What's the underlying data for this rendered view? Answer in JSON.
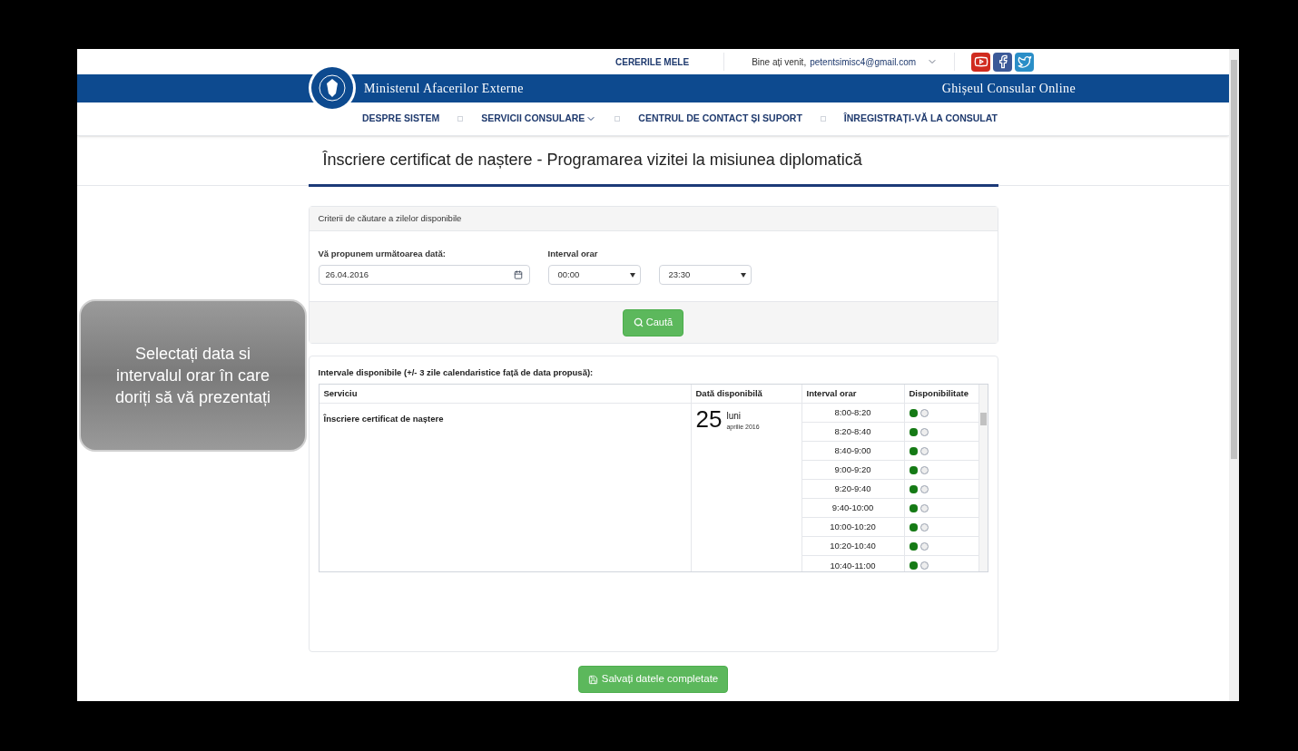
{
  "top_bar": {
    "my_requests": "CERERILE MELE",
    "welcome": "Bine ați venit,",
    "email": "petentsimisc4@gmail.com"
  },
  "header": {
    "ministry": "Ministerul Afacerilor Externe",
    "portal": "Ghișeul Consular Online"
  },
  "nav": [
    {
      "label": "DESPRE SISTEM",
      "dropdown": false
    },
    {
      "label": "SERVICII CONSULARE",
      "dropdown": true
    },
    {
      "label": "CENTRUL DE CONTACT ȘI SUPORT",
      "dropdown": false
    },
    {
      "label": "ÎNREGISTRAȚI-VĂ LA CONSULAT",
      "dropdown": false
    }
  ],
  "page_title": "Înscriere certificat de naștere - Programarea vizitei la misiunea diplomatică",
  "search_panel": {
    "heading": "Criterii de căutare a zilelor disponibile",
    "date_label": "Vă propunem următoarea dată:",
    "date_value": "26.04.2016",
    "interval_label": "Interval orar",
    "from": "00:00",
    "to": "23:30",
    "search_button": "Caută"
  },
  "results": {
    "heading": "Intervale disponibile (+/- 3 zile calendaristice față de data propusă):",
    "columns": [
      "Serviciu",
      "Dată disponibilă",
      "Interval orar",
      "Disponibilitate"
    ],
    "service": "Înscriere certificat de naștere",
    "day": "25",
    "weekday": "luni",
    "month": "aprilie 2016",
    "slots": [
      {
        "time": "8:00-8:20",
        "available": true,
        "selected": false
      },
      {
        "time": "8:20-8:40",
        "available": true,
        "selected": false
      },
      {
        "time": "8:40-9:00",
        "available": true,
        "selected": false
      },
      {
        "time": "9:00-9:20",
        "available": true,
        "selected": false
      },
      {
        "time": "9:20-9:40",
        "available": true,
        "selected": false
      },
      {
        "time": "9:40-10:00",
        "available": true,
        "selected": false
      },
      {
        "time": "10:00-10:20",
        "available": true,
        "selected": false
      },
      {
        "time": "10:20-10:40",
        "available": true,
        "selected": false
      },
      {
        "time": "10:40-11:00",
        "available": true,
        "selected": false
      }
    ]
  },
  "save_button": "Salvați datele completate",
  "tooltip": "Selectați data si intervalul orar în care doriți să vă prezentați"
}
